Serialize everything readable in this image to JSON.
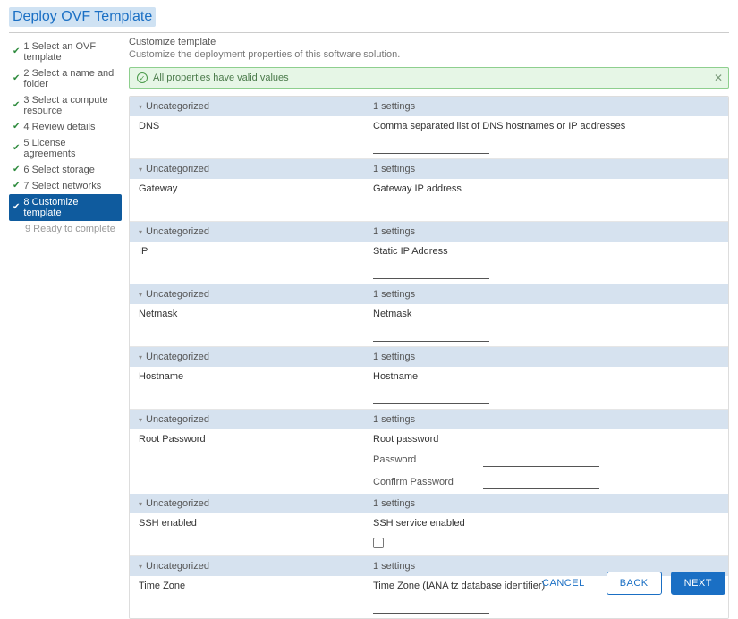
{
  "title": "Deploy OVF Template",
  "steps": [
    {
      "label": "1 Select an OVF template",
      "done": true
    },
    {
      "label": "2 Select a name and folder",
      "done": true
    },
    {
      "label": "3 Select a compute resource",
      "done": true
    },
    {
      "label": "4 Review details",
      "done": true
    },
    {
      "label": "5 License agreements",
      "done": true
    },
    {
      "label": "6 Select storage",
      "done": true
    },
    {
      "label": "7 Select networks",
      "done": true
    },
    {
      "label": "8 Customize template",
      "done": true,
      "active": true
    },
    {
      "label": "9 Ready to complete",
      "done": false,
      "disabled": true
    }
  ],
  "header": {
    "title": "Customize template",
    "subtitle": "Customize the deployment properties of this software solution."
  },
  "banner": {
    "text": "All properties have valid values"
  },
  "group_label": "Uncategorized",
  "settings_count": "1 settings",
  "props": {
    "dns": {
      "label": "DNS",
      "desc": "Comma separated list of DNS hostnames or IP addresses",
      "value": ""
    },
    "gateway": {
      "label": "Gateway",
      "desc": "Gateway IP address",
      "value": ""
    },
    "ip": {
      "label": "IP",
      "desc": "Static IP Address",
      "value": ""
    },
    "netmask": {
      "label": "Netmask",
      "desc": "Netmask",
      "value": ""
    },
    "hostname": {
      "label": "Hostname",
      "desc": "Hostname",
      "value": ""
    },
    "rootpwd": {
      "label": "Root Password",
      "desc": "Root password",
      "password_label": "Password",
      "confirm_label": "Confirm Password",
      "password": "",
      "confirm": ""
    },
    "ssh": {
      "label": "SSH enabled",
      "desc": "SSH service enabled",
      "checked": false
    },
    "tz": {
      "label": "Time Zone",
      "desc": "Time Zone (IANA tz database identifier)",
      "value": ""
    }
  },
  "footer": {
    "cancel": "CANCEL",
    "back": "BACK",
    "next": "NEXT"
  }
}
